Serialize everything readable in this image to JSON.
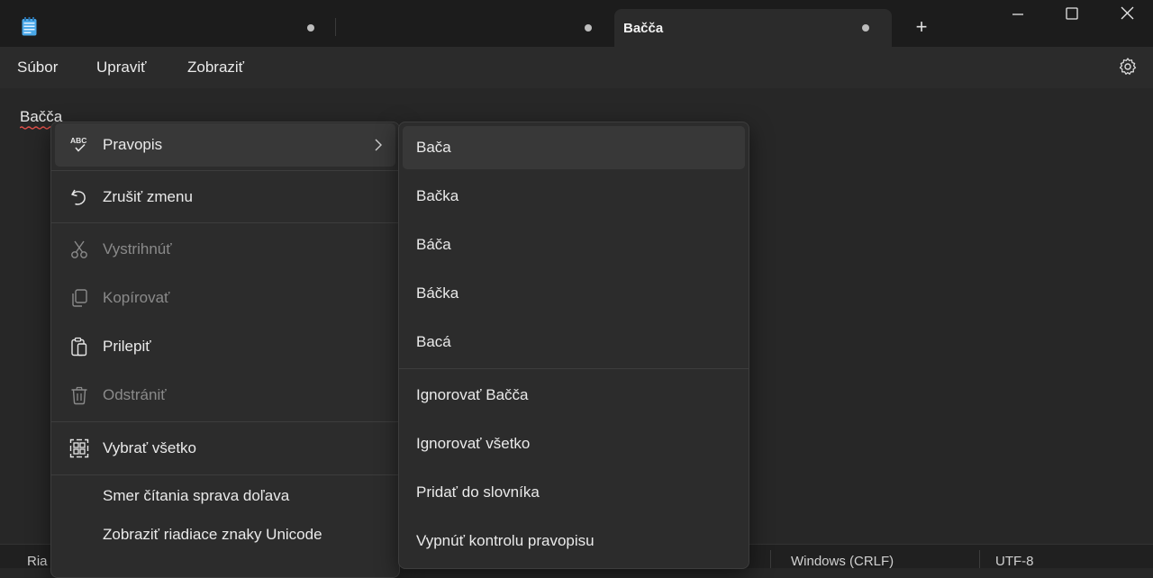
{
  "titlebar": {
    "tabs": [
      {
        "title": "",
        "unsaved": true,
        "active": false
      },
      {
        "title": "",
        "unsaved": true,
        "active": false
      },
      {
        "title": "Bačča",
        "unsaved": true,
        "active": true
      }
    ],
    "new_tab_label": "+"
  },
  "menubar": {
    "items": [
      "Súbor",
      "Upraviť",
      "Zobraziť"
    ],
    "settings_icon": "gear-icon"
  },
  "editor": {
    "text": "Bačča"
  },
  "context_menu": {
    "items": [
      {
        "label": "Pravopis",
        "icon": "spellcheck-icon",
        "enabled": true,
        "submenu": true
      },
      {
        "label": "Zrušiť zmenu",
        "icon": "undo-icon",
        "enabled": true
      },
      {
        "label": "Vystrihnúť",
        "icon": "cut-icon",
        "enabled": false
      },
      {
        "label": "Kopírovať",
        "icon": "copy-icon",
        "enabled": false
      },
      {
        "label": "Prilepiť",
        "icon": "paste-icon",
        "enabled": true
      },
      {
        "label": "Odstrániť",
        "icon": "delete-icon",
        "enabled": false
      },
      {
        "label": "Vybrať všetko",
        "icon": "select-all-icon",
        "enabled": true
      },
      {
        "label": "Smer čítania sprava doľava",
        "enabled": true
      },
      {
        "label": "Zobraziť riadiace znaky Unicode",
        "enabled": true
      }
    ]
  },
  "spelling_submenu": {
    "suggestions": [
      "Bača",
      "Bačka",
      "Báča",
      "Báčka",
      "Bacá"
    ],
    "actions": [
      "Ignorovať Bačča",
      "Ignorovať všetko",
      "Pridať do slovníka",
      "Vypnúť kontrolu pravopisu"
    ]
  },
  "statusbar": {
    "position_partial": "Ria",
    "line_ending": "Windows (CRLF)",
    "encoding": "UTF-8"
  },
  "colors": {
    "titlebar_bg": "#1c1c1c",
    "editor_bg": "#272727",
    "menu_bg": "#2c2c2c",
    "highlight": "#383838",
    "app_icon_blue": "#4aa8e8",
    "misspelling_red": "#e0504a"
  }
}
